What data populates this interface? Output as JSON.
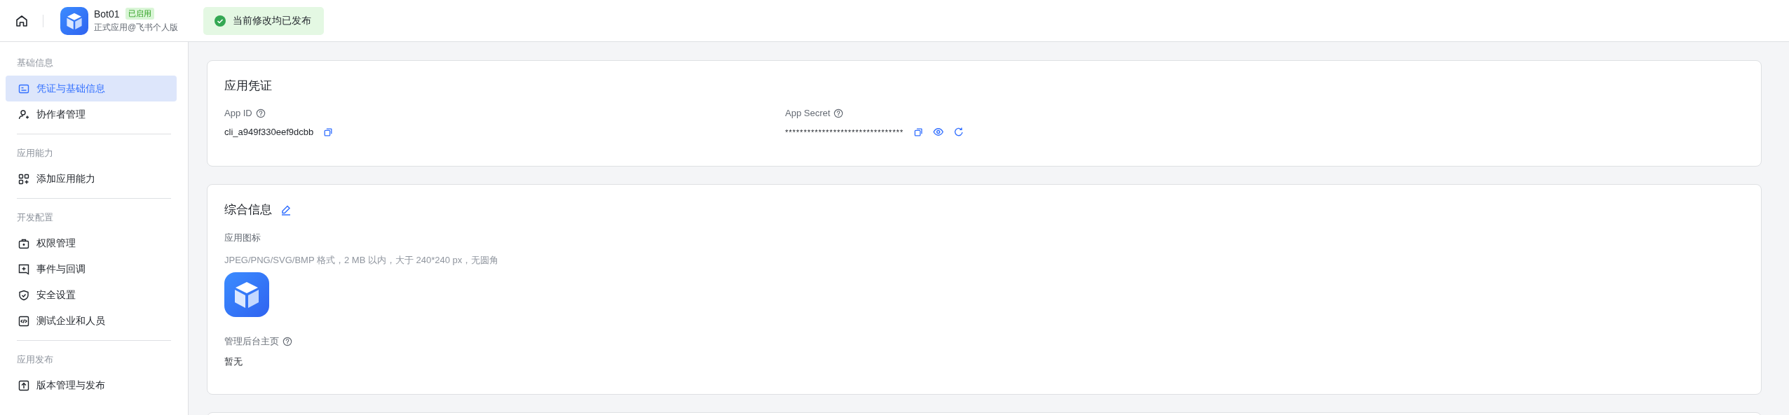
{
  "header": {
    "app": {
      "name": "Bot01",
      "status_badge": "已启用",
      "subtitle": "正式应用@飞书个人版"
    },
    "notice": "当前修改均已发布"
  },
  "sidebar": {
    "groups": [
      {
        "label": "基础信息",
        "items": [
          {
            "label": "凭证与基础信息",
            "selected": true
          },
          {
            "label": "协作者管理",
            "selected": false
          }
        ]
      },
      {
        "label": "应用能力",
        "items": [
          {
            "label": "添加应用能力",
            "selected": false
          }
        ]
      },
      {
        "label": "开发配置",
        "items": [
          {
            "label": "权限管理",
            "selected": false
          },
          {
            "label": "事件与回调",
            "selected": false
          },
          {
            "label": "安全设置",
            "selected": false
          },
          {
            "label": "测试企业和人员",
            "selected": false
          }
        ]
      },
      {
        "label": "应用发布",
        "items": [
          {
            "label": "版本管理与发布",
            "selected": false
          }
        ]
      }
    ]
  },
  "credentials_card": {
    "title": "应用凭证",
    "app_id": {
      "label": "App ID",
      "value": "cli_a949f330eef9dcbb"
    },
    "app_secret": {
      "label": "App Secret",
      "value": "********************************"
    }
  },
  "info_card": {
    "title": "综合信息",
    "app_icon": {
      "label": "应用图标",
      "hint": "JPEG/PNG/SVG/BMP 格式，2 MB 以内，大于 240*240 px，无圆角"
    },
    "admin_homepage": {
      "label": "管理后台主页",
      "value": "暂无"
    }
  }
}
